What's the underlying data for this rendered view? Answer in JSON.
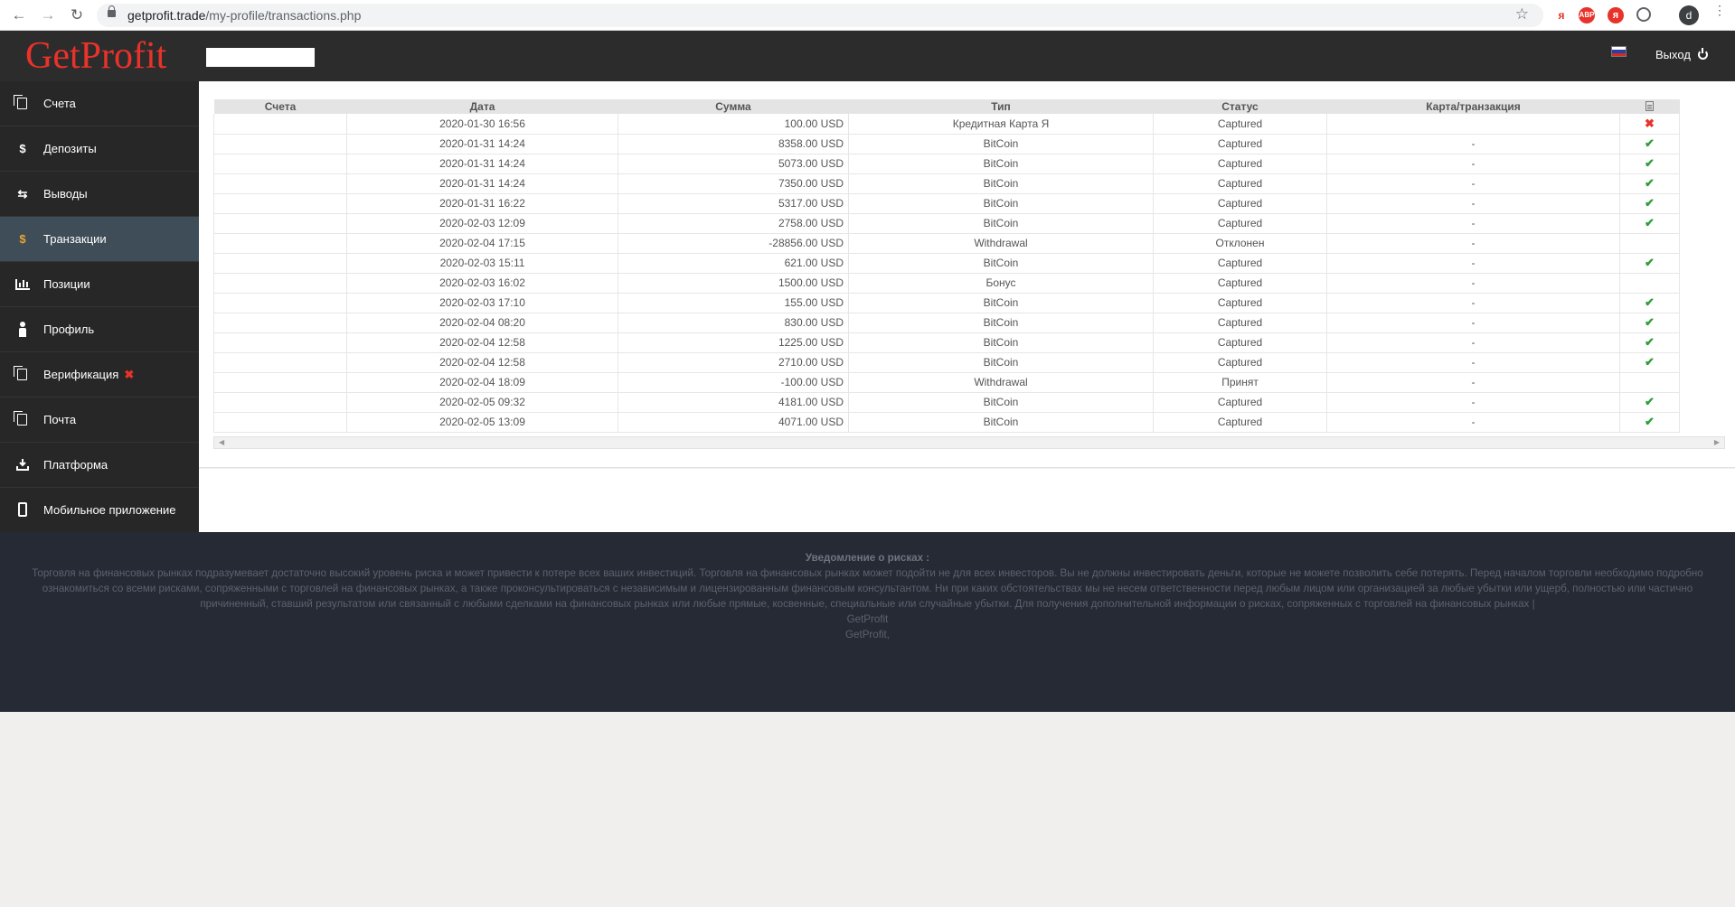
{
  "browser": {
    "url_host": "getprofit.trade",
    "url_path": "/my-profile/transactions.php",
    "profile_initial": "d"
  },
  "header": {
    "logo": "GetProfit",
    "logout_label": "Выход"
  },
  "sidebar": {
    "items": [
      {
        "label": "Счета",
        "icon": "accounts-icon"
      },
      {
        "label": "Депозиты",
        "icon": "dollar-icon"
      },
      {
        "label": "Выводы",
        "icon": "transfer-arrows-icon"
      },
      {
        "label": "Транзакции",
        "icon": "dollar-icon",
        "active": true
      },
      {
        "label": "Позиции",
        "icon": "bar-chart-icon"
      },
      {
        "label": "Профиль",
        "icon": "person-icon"
      },
      {
        "label": "Верификация",
        "icon": "verification-icon",
        "status": "✖"
      },
      {
        "label": "Почта",
        "icon": "mail-icon"
      },
      {
        "label": "Платформа",
        "icon": "download-icon"
      },
      {
        "label": "Мобильное приложение",
        "icon": "mobile-icon"
      }
    ]
  },
  "table": {
    "columns": [
      "Счета",
      "Дата",
      "Сумма",
      "Тип",
      "Статус",
      "Карта/транзакция"
    ],
    "rows": [
      {
        "date": "2020-01-30 16:56",
        "amount": "100.00 USD",
        "type": "Кредитная Карта Я",
        "status": "Captured",
        "card": "",
        "mark": "bad"
      },
      {
        "date": "2020-01-31 14:24",
        "amount": "8358.00 USD",
        "type": "BitCoin",
        "status": "Captured",
        "card": "-",
        "mark": "ok"
      },
      {
        "date": "2020-01-31 14:24",
        "amount": "5073.00 USD",
        "type": "BitCoin",
        "status": "Captured",
        "card": "-",
        "mark": "ok"
      },
      {
        "date": "2020-01-31 14:24",
        "amount": "7350.00 USD",
        "type": "BitCoin",
        "status": "Captured",
        "card": "-",
        "mark": "ok"
      },
      {
        "date": "2020-01-31 16:22",
        "amount": "5317.00 USD",
        "type": "BitCoin",
        "status": "Captured",
        "card": "-",
        "mark": "ok"
      },
      {
        "date": "2020-02-03 12:09",
        "amount": "2758.00 USD",
        "type": "BitCoin",
        "status": "Captured",
        "card": "-",
        "mark": "ok"
      },
      {
        "date": "2020-02-04 17:15",
        "amount": "-28856.00 USD",
        "type": "Withdrawal",
        "status": "Отклонен",
        "card": "-",
        "mark": ""
      },
      {
        "date": "2020-02-03 15:11",
        "amount": "621.00 USD",
        "type": "BitCoin",
        "status": "Captured",
        "card": "-",
        "mark": "ok"
      },
      {
        "date": "2020-02-03 16:02",
        "amount": "1500.00 USD",
        "type": "Бонус",
        "status": "Captured",
        "card": "-",
        "mark": ""
      },
      {
        "date": "2020-02-03 17:10",
        "amount": "155.00 USD",
        "type": "BitCoin",
        "status": "Captured",
        "card": "-",
        "mark": "ok"
      },
      {
        "date": "2020-02-04 08:20",
        "amount": "830.00 USD",
        "type": "BitCoin",
        "status": "Captured",
        "card": "-",
        "mark": "ok"
      },
      {
        "date": "2020-02-04 12:58",
        "amount": "1225.00 USD",
        "type": "BitCoin",
        "status": "Captured",
        "card": "-",
        "mark": "ok"
      },
      {
        "date": "2020-02-04 12:58",
        "amount": "2710.00 USD",
        "type": "BitCoin",
        "status": "Captured",
        "card": "-",
        "mark": "ok"
      },
      {
        "date": "2020-02-04 18:09",
        "amount": "-100.00 USD",
        "type": "Withdrawal",
        "status": "Принят",
        "card": "-",
        "mark": ""
      },
      {
        "date": "2020-02-05 09:32",
        "amount": "4181.00 USD",
        "type": "BitCoin",
        "status": "Captured",
        "card": "-",
        "mark": "ok"
      },
      {
        "date": "2020-02-05 13:09",
        "amount": "4071.00 USD",
        "type": "BitCoin",
        "status": "Captured",
        "card": "-",
        "mark": "ok"
      }
    ]
  },
  "footer": {
    "title": "Уведомление о рисках :",
    "text": "Торговля на финансовых рынках подразумевает достаточно высокий уровень риска и может привести к потере всех ваших инвестиций. Торговля на финансовых рынках может подойти не для всех инвесторов. Вы не должны инвестировать деньги, которые не можете позволить себе потерять. Перед началом торговли необходимо подробно ознакомиться со всеми рисками, сопряженными с торговлей на финансовых рынках, а также проконсультироваться с независимым и лицензированным финансовым консультантом. Ни при каких обстоятельствах мы не несем ответственности перед любым лицом или организацией за любые убытки или ущерб, полностью или частично причиненный, ставший результатом или связанный с любыми сделками на финансовых рынках или любые прямые, косвенные, специальные или случайные убытки. Для получения дополнительной информации о рисках, сопряженных с торговлей на финансовых рынках |",
    "line2": "GetProfit",
    "line3": "GetProfit,"
  },
  "colors": {
    "brand_red": "#e8322a",
    "ok_green": "#2e9e3a",
    "sidebar_active": "#3e4d57",
    "footer_bg": "#262a35"
  }
}
